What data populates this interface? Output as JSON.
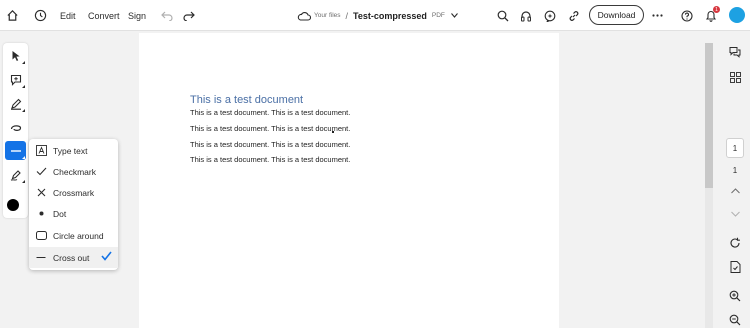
{
  "toolbar": {
    "edit_label": "Edit",
    "convert_label": "Convert",
    "sign_label": "Sign",
    "breadcrumb_location": "Your files",
    "breadcrumb_separator": "/",
    "file_name": "Test-compressed",
    "file_type": "PDF",
    "download_label": "Download",
    "notification_count": "1"
  },
  "left_tools": [
    {
      "icon": "select-arrow-icon"
    },
    {
      "icon": "add-comment-icon"
    },
    {
      "icon": "highlight-pen-icon"
    },
    {
      "icon": "freehand-draw-icon"
    },
    {
      "icon": "cross-out-line-icon",
      "active": true
    },
    {
      "icon": "sign-pen-icon"
    }
  ],
  "color_swatch": "#000000",
  "tool_menu": {
    "items": [
      {
        "label": "Type text",
        "icon": "text-box-icon"
      },
      {
        "label": "Checkmark",
        "icon": "checkmark-icon"
      },
      {
        "label": "Crossmark",
        "icon": "crossmark-icon"
      },
      {
        "label": "Dot",
        "icon": "dot-icon"
      },
      {
        "label": "Circle around",
        "icon": "circle-around-icon"
      },
      {
        "label": "Cross out",
        "icon": "cross-out-icon",
        "selected": true
      }
    ]
  },
  "document": {
    "title": "This is a test document",
    "lines": [
      "This is a test document. This is a test document.",
      "This is a test document. This is a test document.",
      "This is a test document. This is a test document.",
      "This is a test document. This is a test document."
    ]
  },
  "pagination": {
    "current_page": "1",
    "total_pages": "1"
  },
  "accent_color": "#1473e6"
}
